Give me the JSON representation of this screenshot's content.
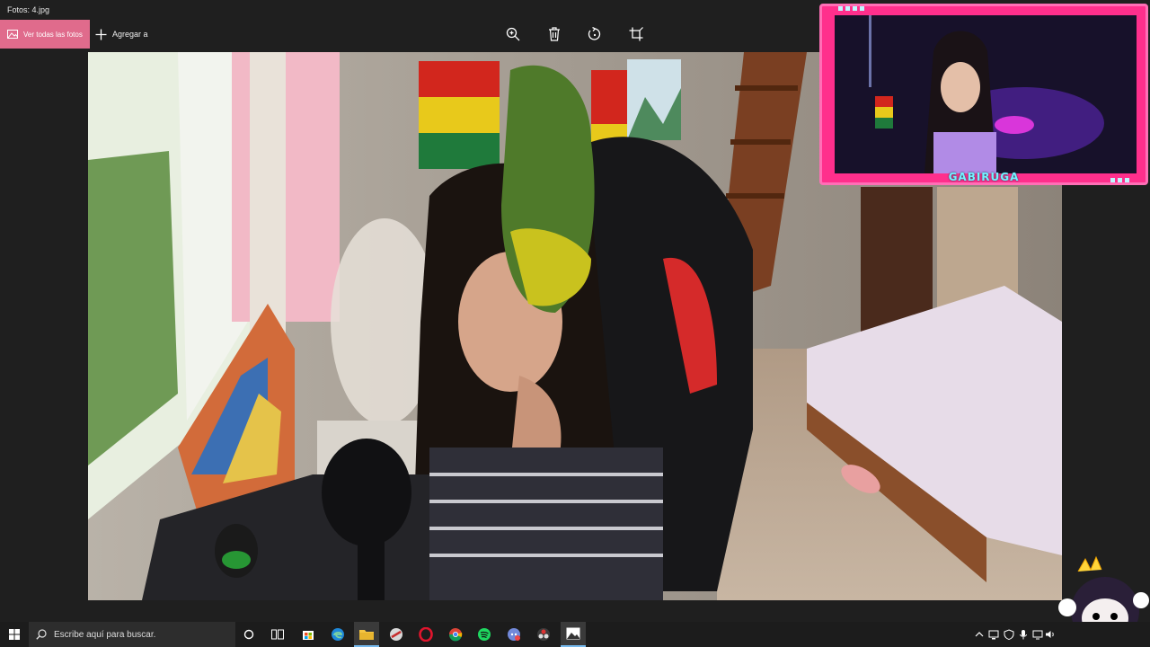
{
  "window": {
    "title": "Fotos: 4.jpg"
  },
  "toolbar": {
    "all_photos_label": "Ver todas las fotos",
    "add_to_label": "Agregar a",
    "icons": [
      "zoom-in-icon",
      "delete-icon",
      "rotate-icon",
      "crop-icon"
    ]
  },
  "overlay": {
    "name": "GABIRUGA"
  },
  "taskbar": {
    "search_placeholder": "Escribe aquí para buscar.",
    "apps": [
      "cortana",
      "task-view",
      "store",
      "edge",
      "file-explorer",
      "app",
      "opera",
      "chrome",
      "spotify",
      "discord",
      "obs",
      "photos"
    ]
  },
  "colors": {
    "accent": "#e06b8c",
    "overlay_frame": "#ff2f8c",
    "overlay_name": "#73f2ff",
    "taskbar": "#1c1c1c"
  }
}
